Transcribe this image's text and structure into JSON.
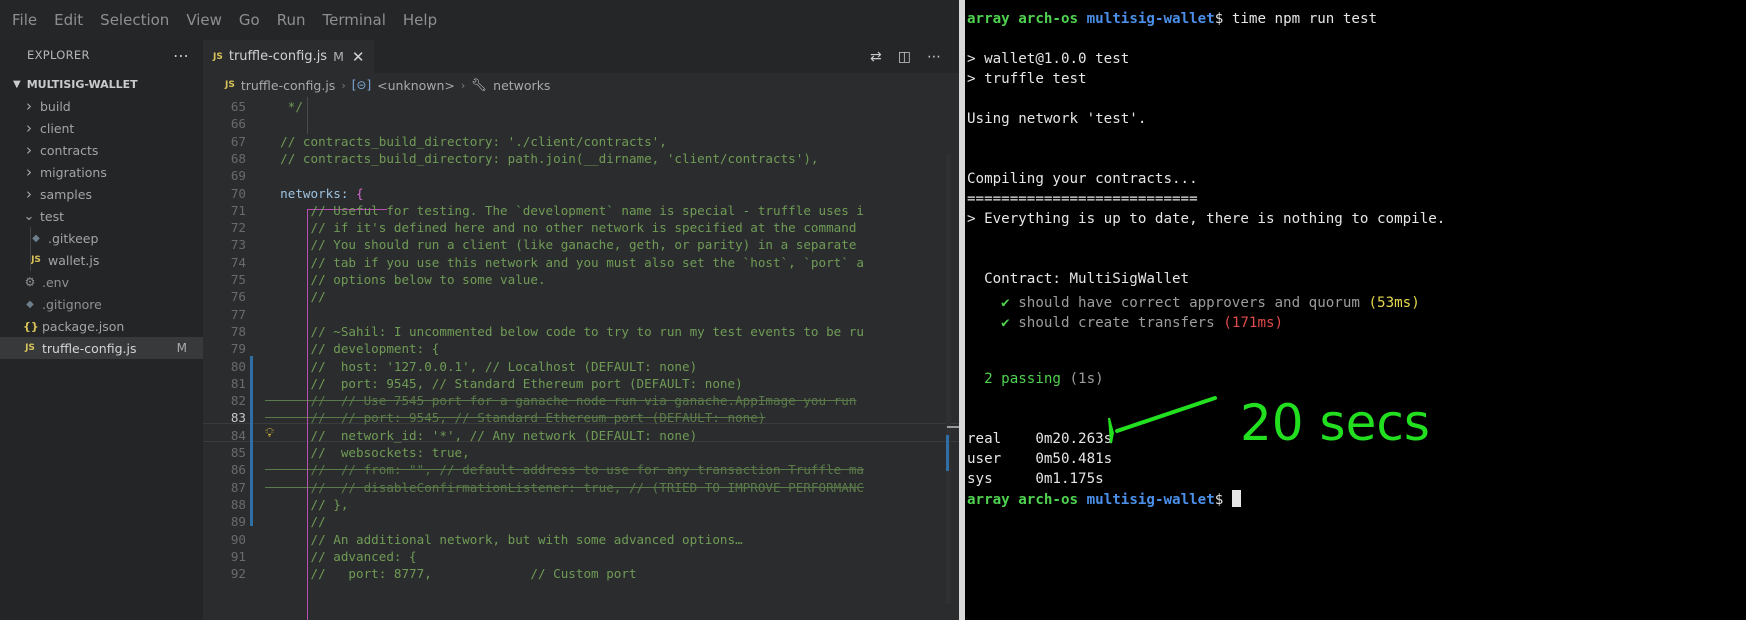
{
  "menubar": {
    "items": [
      "File",
      "Edit",
      "Selection",
      "View",
      "Go",
      "Run",
      "Terminal",
      "Help"
    ]
  },
  "sidebar": {
    "title": "EXPLORER",
    "project": "MULTISIG-WALLET",
    "items": [
      {
        "label": "build",
        "type": "folder"
      },
      {
        "label": "client",
        "type": "folder"
      },
      {
        "label": "contracts",
        "type": "folder"
      },
      {
        "label": "migrations",
        "type": "folder"
      },
      {
        "label": "samples",
        "type": "folder"
      },
      {
        "label": "test",
        "type": "folder-open"
      },
      {
        "label": ".gitkeep",
        "type": "file"
      },
      {
        "label": "wallet.js",
        "type": "js"
      },
      {
        "label": ".env",
        "type": "file"
      },
      {
        "label": ".gitignore",
        "type": "file"
      },
      {
        "label": "package.json",
        "type": "json"
      },
      {
        "label": "truffle-config.js",
        "type": "js",
        "badge": "M"
      }
    ]
  },
  "editor": {
    "tab": {
      "icon": "JS",
      "label": "truffle-config.js",
      "status": "M"
    },
    "breadcrumb": [
      "truffle-config.js",
      "<unknown>",
      "networks"
    ],
    "lines": [
      {
        "n": "65",
        "text": "   */"
      },
      {
        "n": "66",
        "text": ""
      },
      {
        "n": "67",
        "text": "  // contracts_build_directory: './client/contracts',"
      },
      {
        "n": "68",
        "text": "  // contracts_build_directory: path.join(__dirname, 'client/contracts'),"
      },
      {
        "n": "69",
        "text": ""
      },
      {
        "n": "70",
        "text": "  networks: {"
      },
      {
        "n": "71",
        "text": "      // Useful for testing. The `development` name is special - truffle uses i"
      },
      {
        "n": "72",
        "text": "      // if it's defined here and no other network is specified at the command"
      },
      {
        "n": "73",
        "text": "      // You should run a client (like ganache, geth, or parity) in a separate"
      },
      {
        "n": "74",
        "text": "      // tab if you use this network and you must also set the `host`, `port` a"
      },
      {
        "n": "75",
        "text": "      // options below to some value."
      },
      {
        "n": "76",
        "text": "      //"
      },
      {
        "n": "77",
        "text": ""
      },
      {
        "n": "78",
        "text": "      // ~Sahil: I uncommented below code to try to run my test events to be ru"
      },
      {
        "n": "79",
        "text": "      // development: {"
      },
      {
        "n": "80",
        "text": "      //  host: '127.0.0.1', // Localhost (DEFAULT: none)"
      },
      {
        "n": "81",
        "text": "      //  port: 9545, // Standard Ethereum port (DEFAULT: none)"
      },
      {
        "n": "82",
        "text": "      //  // Use 7545 port for a ganache node run via ganache.AppImage you run"
      },
      {
        "n": "83",
        "text": "      //  // port: 9545, // Standard Ethereum port (DEFAULT: none)"
      },
      {
        "n": "84",
        "text": "      //  network_id: '*', // Any network (DEFAULT: none)"
      },
      {
        "n": "85",
        "text": "      //  websockets: true,"
      },
      {
        "n": "86",
        "text": "      //  // from: \"\", // default address to use for any transaction Truffle ma"
      },
      {
        "n": "87",
        "text": "      //  // disableConfirmationListener: true, // (TRIED TO IMPROVE PERFORMANC"
      },
      {
        "n": "88",
        "text": "      // },"
      },
      {
        "n": "89",
        "text": "      //"
      },
      {
        "n": "90",
        "text": "      // An additional network, but with some advanced options…"
      },
      {
        "n": "91",
        "text": "      // advanced: {"
      },
      {
        "n": "92",
        "text": "      //   port: 8777,             // Custom port"
      }
    ],
    "current_line": "83"
  },
  "terminal": {
    "prompt": {
      "user": "array",
      "host": "arch-os",
      "dir": "multisig-wallet",
      "symbol": "$"
    },
    "command": "time npm run test",
    "output": [
      "",
      "> wallet@1.0.0 test",
      "> truffle test",
      "",
      "Using network 'test'.",
      "",
      "",
      "Compiling your contracts...",
      "===========================",
      "> Everything is up to date, there is nothing to compile.",
      "",
      "",
      "  Contract: MultiSigWallet"
    ],
    "tests": [
      {
        "mark": "✔",
        "text": "should have correct approvers and quorum",
        "time": "(53ms)",
        "color": "#e5d84d"
      },
      {
        "mark": "✔",
        "text": "should create transfers",
        "time": "(171ms)",
        "color": "#e04a4a"
      }
    ],
    "passing": {
      "label": "2 passing",
      "time": "(1s)"
    },
    "timing": [
      {
        "label": "real",
        "value": "0m20.263s"
      },
      {
        "label": "user",
        "value": "0m50.481s"
      },
      {
        "label": "sys",
        "value": "0m1.175s"
      }
    ],
    "annotation": "20 secs",
    "annotation_color": "#22e01f"
  }
}
